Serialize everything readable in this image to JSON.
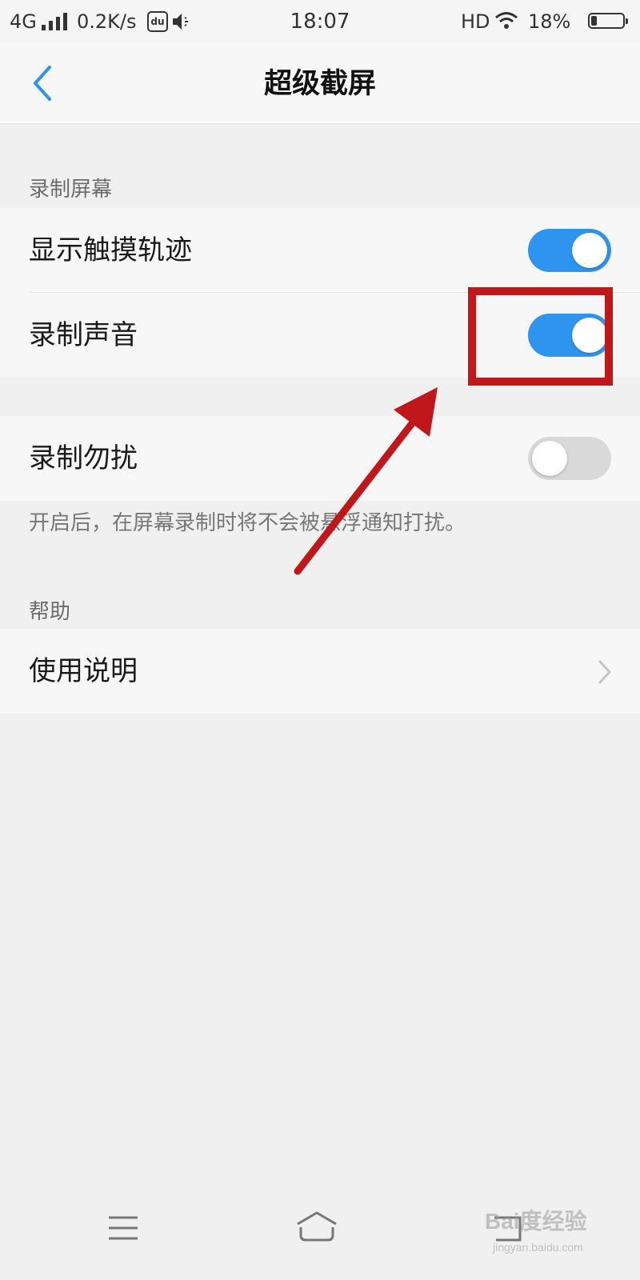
{
  "status_bar": {
    "network": "4G",
    "speed": "0.2K/s",
    "time": "18:07",
    "hd": "HD",
    "battery_percent": "18%",
    "battery_level": 0.18,
    "icons": [
      "signal-icon",
      "du-app-icon",
      "speaker-muted-icon",
      "wifi-icon",
      "battery-icon"
    ]
  },
  "header": {
    "title": "超级截屏",
    "back_icon": "chevron-left-icon"
  },
  "sections": {
    "record_screen": {
      "label": "录制屏幕",
      "items": [
        {
          "label": "显示触摸轨迹",
          "toggle_on": true
        },
        {
          "label": "录制声音",
          "toggle_on": true
        }
      ]
    },
    "dnd": {
      "label": "录制勿扰",
      "toggle_on": false,
      "description": "开启后，在屏幕录制时将不会被悬浮通知打扰。"
    },
    "help": {
      "label": "帮助",
      "items": [
        {
          "label": "使用说明",
          "icon": "chevron-right-icon"
        }
      ]
    }
  },
  "nav_bar": {
    "icons": [
      "menu-icon",
      "home-icon",
      "back-icon"
    ]
  },
  "annotation": {
    "color": "#c0181a",
    "highlight": "box around the 录制声音 toggle",
    "arrow": "arrow pointing to the highlighted toggle"
  },
  "colors": {
    "accent": "#2d95f0",
    "toggle_off": "#d9d9d9",
    "background": "#f0f0f0"
  },
  "watermark": {
    "main": "Bai度经验",
    "sub": "jingyan.baidu.com"
  }
}
